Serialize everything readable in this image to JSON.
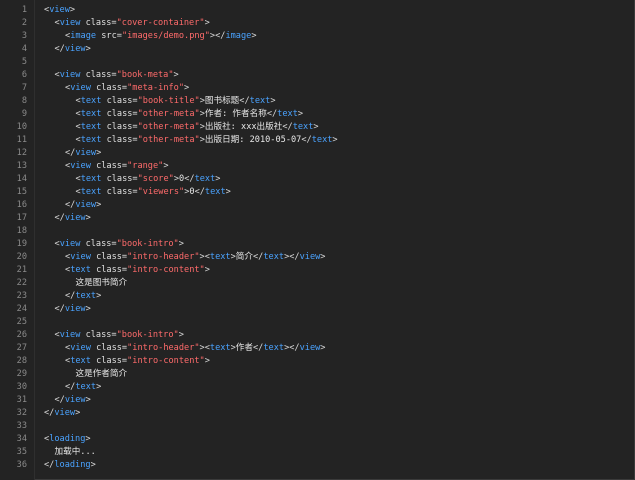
{
  "colors": {
    "background": "#232323",
    "line_number": "#8a8a8a",
    "tag": "#4aa3ff",
    "attribute": "#e0e0e0",
    "string": "#ff6b6b",
    "text": "#e8e8e8",
    "punctuation": "#d8d8d8"
  },
  "lines": [
    {
      "n": "1",
      "indent": 0,
      "tokens": [
        {
          "t": "p",
          "v": "<"
        },
        {
          "t": "t",
          "v": "view"
        },
        {
          "t": "p",
          "v": ">"
        }
      ]
    },
    {
      "n": "2",
      "indent": 1,
      "tokens": [
        {
          "t": "p",
          "v": "<"
        },
        {
          "t": "t",
          "v": "view"
        },
        {
          "t": "a",
          "v": " class="
        },
        {
          "t": "s",
          "v": "\"cover-container\""
        },
        {
          "t": "p",
          "v": ">"
        }
      ]
    },
    {
      "n": "3",
      "indent": 2,
      "tokens": [
        {
          "t": "p",
          "v": "<"
        },
        {
          "t": "t",
          "v": "image"
        },
        {
          "t": "a",
          "v": " src="
        },
        {
          "t": "s",
          "v": "\"images/demo.png\""
        },
        {
          "t": "p",
          "v": "></"
        },
        {
          "t": "t",
          "v": "image"
        },
        {
          "t": "p",
          "v": ">"
        }
      ]
    },
    {
      "n": "4",
      "indent": 1,
      "tokens": [
        {
          "t": "p",
          "v": "</"
        },
        {
          "t": "t",
          "v": "view"
        },
        {
          "t": "p",
          "v": ">"
        }
      ]
    },
    {
      "n": "5",
      "indent": 0,
      "tokens": []
    },
    {
      "n": "6",
      "indent": 1,
      "tokens": [
        {
          "t": "p",
          "v": "<"
        },
        {
          "t": "t",
          "v": "view"
        },
        {
          "t": "a",
          "v": " class="
        },
        {
          "t": "s",
          "v": "\"book-meta\""
        },
        {
          "t": "p",
          "v": ">"
        }
      ]
    },
    {
      "n": "7",
      "indent": 2,
      "tokens": [
        {
          "t": "p",
          "v": "<"
        },
        {
          "t": "t",
          "v": "view"
        },
        {
          "t": "a",
          "v": " class="
        },
        {
          "t": "s",
          "v": "\"meta-info\""
        },
        {
          "t": "p",
          "v": ">"
        }
      ]
    },
    {
      "n": "8",
      "indent": 3,
      "tokens": [
        {
          "t": "p",
          "v": "<"
        },
        {
          "t": "t",
          "v": "text"
        },
        {
          "t": "a",
          "v": " class="
        },
        {
          "t": "s",
          "v": "\"book-title\""
        },
        {
          "t": "p",
          "v": ">"
        },
        {
          "t": "x",
          "v": "图书标题"
        },
        {
          "t": "p",
          "v": "</"
        },
        {
          "t": "t",
          "v": "text"
        },
        {
          "t": "p",
          "v": ">"
        }
      ]
    },
    {
      "n": "9",
      "indent": 3,
      "tokens": [
        {
          "t": "p",
          "v": "<"
        },
        {
          "t": "t",
          "v": "text"
        },
        {
          "t": "a",
          "v": " class="
        },
        {
          "t": "s",
          "v": "\"other-meta\""
        },
        {
          "t": "p",
          "v": ">"
        },
        {
          "t": "x",
          "v": "作者: 作者名称"
        },
        {
          "t": "p",
          "v": "</"
        },
        {
          "t": "t",
          "v": "text"
        },
        {
          "t": "p",
          "v": ">"
        }
      ]
    },
    {
      "n": "10",
      "indent": 3,
      "tokens": [
        {
          "t": "p",
          "v": "<"
        },
        {
          "t": "t",
          "v": "text"
        },
        {
          "t": "a",
          "v": " class="
        },
        {
          "t": "s",
          "v": "\"other-meta\""
        },
        {
          "t": "p",
          "v": ">"
        },
        {
          "t": "x",
          "v": "出版社: xxx出版社"
        },
        {
          "t": "p",
          "v": "</"
        },
        {
          "t": "t",
          "v": "text"
        },
        {
          "t": "p",
          "v": ">"
        }
      ]
    },
    {
      "n": "11",
      "indent": 3,
      "tokens": [
        {
          "t": "p",
          "v": "<"
        },
        {
          "t": "t",
          "v": "text"
        },
        {
          "t": "a",
          "v": " class="
        },
        {
          "t": "s",
          "v": "\"other-meta\""
        },
        {
          "t": "p",
          "v": ">"
        },
        {
          "t": "x",
          "v": "出版日期: 2010-05-07"
        },
        {
          "t": "p",
          "v": "</"
        },
        {
          "t": "t",
          "v": "text"
        },
        {
          "t": "p",
          "v": ">"
        }
      ]
    },
    {
      "n": "12",
      "indent": 2,
      "tokens": [
        {
          "t": "p",
          "v": "</"
        },
        {
          "t": "t",
          "v": "view"
        },
        {
          "t": "p",
          "v": ">"
        }
      ]
    },
    {
      "n": "13",
      "indent": 2,
      "tokens": [
        {
          "t": "p",
          "v": "<"
        },
        {
          "t": "t",
          "v": "view"
        },
        {
          "t": "a",
          "v": " class="
        },
        {
          "t": "s",
          "v": "\"range\""
        },
        {
          "t": "p",
          "v": ">"
        }
      ]
    },
    {
      "n": "14",
      "indent": 3,
      "tokens": [
        {
          "t": "p",
          "v": "<"
        },
        {
          "t": "t",
          "v": "text"
        },
        {
          "t": "a",
          "v": " class="
        },
        {
          "t": "s",
          "v": "\"score\""
        },
        {
          "t": "p",
          "v": ">"
        },
        {
          "t": "x",
          "v": "0"
        },
        {
          "t": "p",
          "v": "</"
        },
        {
          "t": "t",
          "v": "text"
        },
        {
          "t": "p",
          "v": ">"
        }
      ]
    },
    {
      "n": "15",
      "indent": 3,
      "tokens": [
        {
          "t": "p",
          "v": "<"
        },
        {
          "t": "t",
          "v": "text"
        },
        {
          "t": "a",
          "v": " class="
        },
        {
          "t": "s",
          "v": "\"viewers\""
        },
        {
          "t": "p",
          "v": ">"
        },
        {
          "t": "x",
          "v": "0"
        },
        {
          "t": "p",
          "v": "</"
        },
        {
          "t": "t",
          "v": "text"
        },
        {
          "t": "p",
          "v": ">"
        }
      ]
    },
    {
      "n": "16",
      "indent": 2,
      "tokens": [
        {
          "t": "p",
          "v": "</"
        },
        {
          "t": "t",
          "v": "view"
        },
        {
          "t": "p",
          "v": ">"
        }
      ]
    },
    {
      "n": "17",
      "indent": 1,
      "tokens": [
        {
          "t": "p",
          "v": "</"
        },
        {
          "t": "t",
          "v": "view"
        },
        {
          "t": "p",
          "v": ">"
        }
      ]
    },
    {
      "n": "18",
      "indent": 0,
      "tokens": []
    },
    {
      "n": "19",
      "indent": 1,
      "tokens": [
        {
          "t": "p",
          "v": "<"
        },
        {
          "t": "t",
          "v": "view"
        },
        {
          "t": "a",
          "v": " class="
        },
        {
          "t": "s",
          "v": "\"book-intro\""
        },
        {
          "t": "p",
          "v": ">"
        }
      ]
    },
    {
      "n": "20",
      "indent": 2,
      "tokens": [
        {
          "t": "p",
          "v": "<"
        },
        {
          "t": "t",
          "v": "view"
        },
        {
          "t": "a",
          "v": " class="
        },
        {
          "t": "s",
          "v": "\"intro-header\""
        },
        {
          "t": "p",
          "v": "><"
        },
        {
          "t": "t",
          "v": "text"
        },
        {
          "t": "p",
          "v": ">"
        },
        {
          "t": "x",
          "v": "简介"
        },
        {
          "t": "p",
          "v": "</"
        },
        {
          "t": "t",
          "v": "text"
        },
        {
          "t": "p",
          "v": "></"
        },
        {
          "t": "t",
          "v": "view"
        },
        {
          "t": "p",
          "v": ">"
        }
      ]
    },
    {
      "n": "21",
      "indent": 2,
      "tokens": [
        {
          "t": "p",
          "v": "<"
        },
        {
          "t": "t",
          "v": "text"
        },
        {
          "t": "a",
          "v": " class="
        },
        {
          "t": "s",
          "v": "\"intro-content\""
        },
        {
          "t": "p",
          "v": ">"
        }
      ]
    },
    {
      "n": "22",
      "indent": 3,
      "tokens": [
        {
          "t": "x",
          "v": "这是图书简介"
        }
      ]
    },
    {
      "n": "23",
      "indent": 2,
      "tokens": [
        {
          "t": "p",
          "v": "</"
        },
        {
          "t": "t",
          "v": "text"
        },
        {
          "t": "p",
          "v": ">"
        }
      ]
    },
    {
      "n": "24",
      "indent": 1,
      "tokens": [
        {
          "t": "p",
          "v": "</"
        },
        {
          "t": "t",
          "v": "view"
        },
        {
          "t": "p",
          "v": ">"
        }
      ]
    },
    {
      "n": "25",
      "indent": 0,
      "tokens": []
    },
    {
      "n": "26",
      "indent": 1,
      "tokens": [
        {
          "t": "p",
          "v": "<"
        },
        {
          "t": "t",
          "v": "view"
        },
        {
          "t": "a",
          "v": " class="
        },
        {
          "t": "s",
          "v": "\"book-intro\""
        },
        {
          "t": "p",
          "v": ">"
        }
      ]
    },
    {
      "n": "27",
      "indent": 2,
      "tokens": [
        {
          "t": "p",
          "v": "<"
        },
        {
          "t": "t",
          "v": "view"
        },
        {
          "t": "a",
          "v": " class="
        },
        {
          "t": "s",
          "v": "\"intro-header\""
        },
        {
          "t": "p",
          "v": "><"
        },
        {
          "t": "t",
          "v": "text"
        },
        {
          "t": "p",
          "v": ">"
        },
        {
          "t": "x",
          "v": "作者"
        },
        {
          "t": "p",
          "v": "</"
        },
        {
          "t": "t",
          "v": "text"
        },
        {
          "t": "p",
          "v": "></"
        },
        {
          "t": "t",
          "v": "view"
        },
        {
          "t": "p",
          "v": ">"
        }
      ]
    },
    {
      "n": "28",
      "indent": 2,
      "tokens": [
        {
          "t": "p",
          "v": "<"
        },
        {
          "t": "t",
          "v": "text"
        },
        {
          "t": "a",
          "v": " class="
        },
        {
          "t": "s",
          "v": "\"intro-content\""
        },
        {
          "t": "p",
          "v": ">"
        }
      ]
    },
    {
      "n": "29",
      "indent": 3,
      "tokens": [
        {
          "t": "x",
          "v": "这是作者简介"
        }
      ]
    },
    {
      "n": "30",
      "indent": 2,
      "tokens": [
        {
          "t": "p",
          "v": "</"
        },
        {
          "t": "t",
          "v": "text"
        },
        {
          "t": "p",
          "v": ">"
        }
      ]
    },
    {
      "n": "31",
      "indent": 1,
      "tokens": [
        {
          "t": "p",
          "v": "</"
        },
        {
          "t": "t",
          "v": "view"
        },
        {
          "t": "p",
          "v": ">"
        }
      ]
    },
    {
      "n": "32",
      "indent": 0,
      "tokens": [
        {
          "t": "p",
          "v": "</"
        },
        {
          "t": "t",
          "v": "view"
        },
        {
          "t": "p",
          "v": ">"
        }
      ]
    },
    {
      "n": "33",
      "indent": 0,
      "tokens": []
    },
    {
      "n": "34",
      "indent": 0,
      "tokens": [
        {
          "t": "p",
          "v": "<"
        },
        {
          "t": "t",
          "v": "loading"
        },
        {
          "t": "p",
          "v": ">"
        }
      ]
    },
    {
      "n": "35",
      "indent": 1,
      "tokens": [
        {
          "t": "x",
          "v": "加载中..."
        }
      ]
    },
    {
      "n": "36",
      "indent": 0,
      "tokens": [
        {
          "t": "p",
          "v": "</"
        },
        {
          "t": "t",
          "v": "loading"
        },
        {
          "t": "p",
          "v": ">"
        }
      ]
    }
  ]
}
